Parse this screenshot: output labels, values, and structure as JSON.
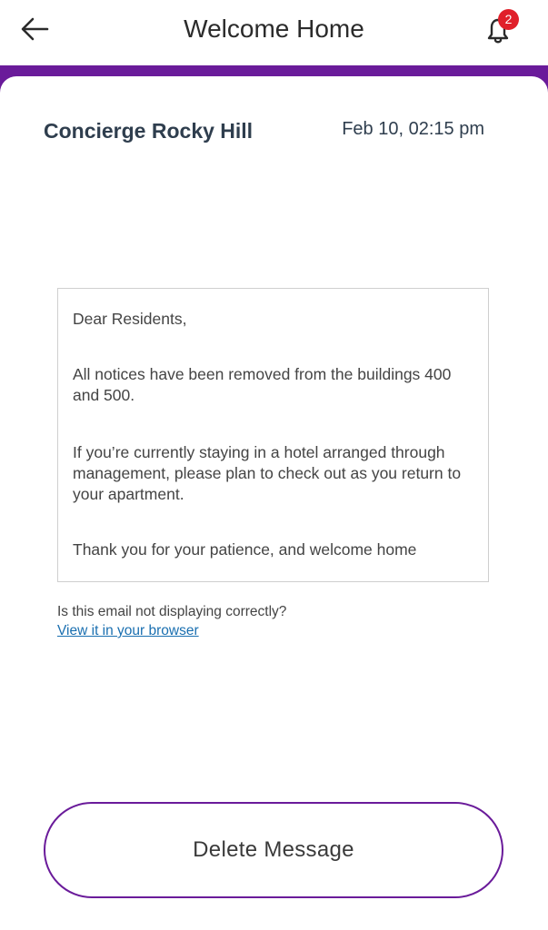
{
  "app_bar": {
    "title": "Welcome Home",
    "back_icon": "arrow-left-icon",
    "bell_icon": "bell-icon",
    "notification_count": "2"
  },
  "theme": {
    "accent": "#6a1b9a",
    "badge": "#e0202a",
    "link": "#1a6fb0"
  },
  "message": {
    "sender": "Concierge Rocky Hill",
    "timestamp": "Feb 10, 02:15 pm",
    "body": {
      "greeting": "Dear Residents,",
      "paragraph1": "All notices have been removed from the buildings 400 and 500.",
      "paragraph2": "If you’re currently staying in a hotel arranged through management, please plan to check out as you return to your apartment.",
      "closing": "Thank you for your patience, and welcome home"
    },
    "display_notice": "Is this email not displaying correctly?",
    "browser_link": "View it in your browser"
  },
  "actions": {
    "delete_label": "Delete Message"
  }
}
